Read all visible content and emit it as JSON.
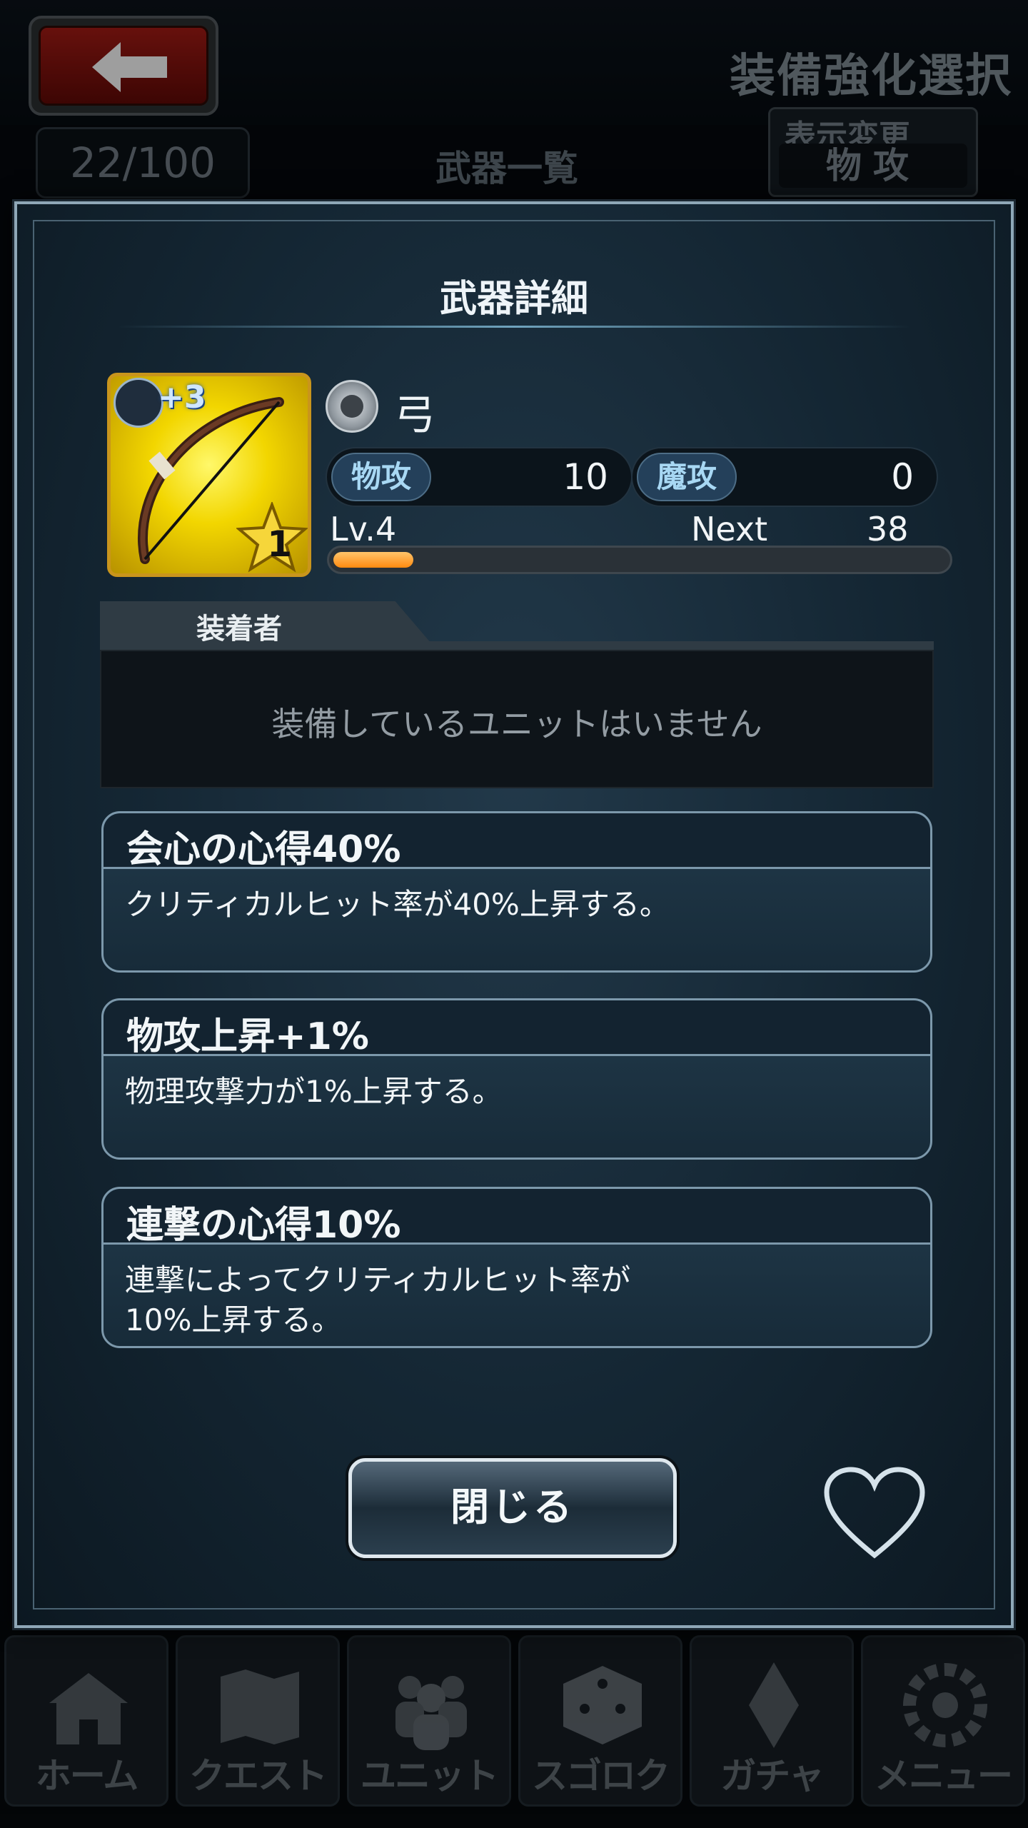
{
  "header": {
    "title": "装備強化選択",
    "count": "22/100",
    "list_title": "武器一覧",
    "view_toggle_label": "表示変更",
    "view_toggle_value": "物攻"
  },
  "dialog": {
    "title": "武器詳細",
    "weapon": {
      "refine": "+3",
      "rarity": "1",
      "type": "弓",
      "stats": [
        {
          "label": "物攻",
          "value": "10"
        },
        {
          "label": "魔攻",
          "value": "0"
        }
      ],
      "level": "Lv.4",
      "next_label": "Next",
      "next_value": "38",
      "exp_progress": 0.13
    },
    "equipper": {
      "tab_label": "装着者",
      "empty_text": "装備しているユニットはいません"
    },
    "skills": [
      {
        "name": "会心の心得40%",
        "desc": "クリティカルヒット率が40%上昇する。"
      },
      {
        "name": "物攻上昇+1%",
        "desc": "物理攻撃力が1%上昇する。"
      },
      {
        "name": "連撃の心得10%",
        "desc": "連撃によってクリティカルヒット率が\n10%上昇する。"
      }
    ],
    "close_label": "閉じる"
  },
  "bottom_nav": [
    {
      "label": "ホーム",
      "icon": "castle-icon"
    },
    {
      "label": "クエスト",
      "icon": "map-icon"
    },
    {
      "label": "ユニット",
      "icon": "units-icon"
    },
    {
      "label": "スゴロク",
      "icon": "dice-icon"
    },
    {
      "label": "ガチャ",
      "icon": "crystal-icon"
    },
    {
      "label": "メニュー",
      "icon": "gear-icon"
    }
  ],
  "colors": {
    "accent_orange": "#ff8a10",
    "panel_border": "#7c98ab",
    "item_frame_gold": "#c9951c"
  }
}
